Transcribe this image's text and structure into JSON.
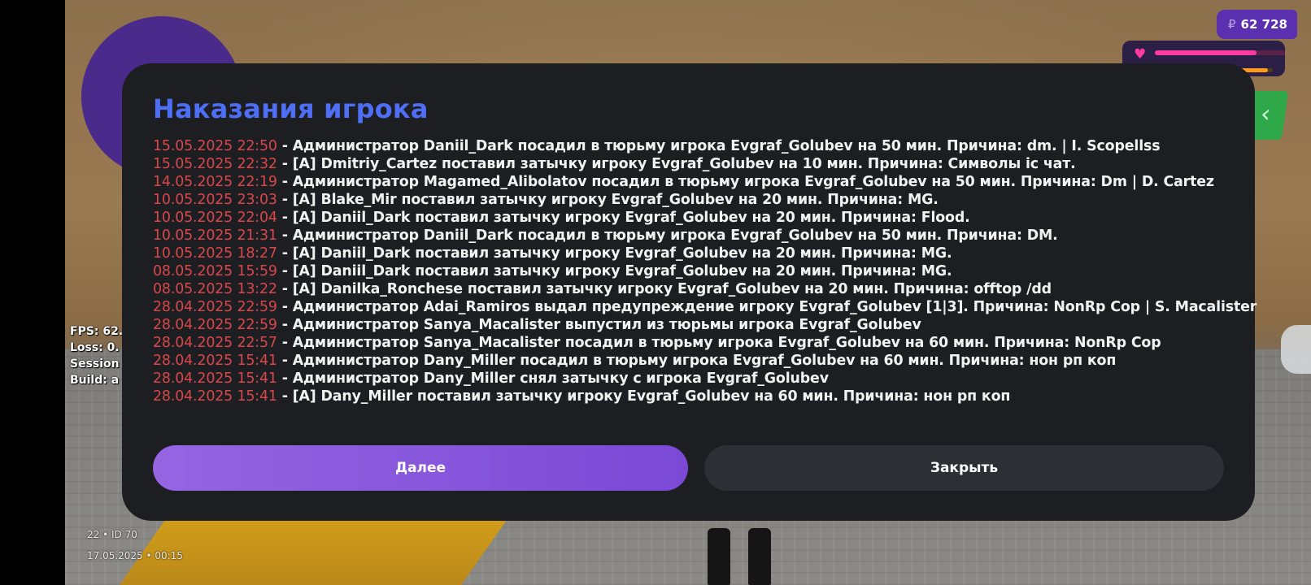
{
  "hud": {
    "money_currency": "₽",
    "money_amount": "62 728",
    "health_fraction": 0.78,
    "armor_fraction": 0.95,
    "fps_label": "FPS: 62.",
    "loss_label": "Loss: 0.",
    "session_label": "Session",
    "build_label": "Build: a",
    "player_id": "22 • ID 70",
    "datetime": "17.05.2025 • 00:15"
  },
  "modal": {
    "title": "Наказания игрока",
    "entries": [
      {
        "date": "15.05.2025 22:50",
        "text": " - Администратор Daniil_Dark посадил в тюрьму игрока Evgraf_Golubev на 50 мин. Причина: dm. | I. Scopellss"
      },
      {
        "date": "15.05.2025 22:32",
        "text": " - [A] Dmitriy_Cartez поставил затычку игроку Evgraf_Golubev на 10 мин. Причина: Символы ic чат."
      },
      {
        "date": "14.05.2025 22:19",
        "text": " - Администратор Magamed_Alibolatov посадил в тюрьму игрока Evgraf_Golubev на 50 мин. Причина: Dm | D. Cartez"
      },
      {
        "date": "10.05.2025 23:03",
        "text": " - [A] Blake_Mir поставил затычку игроку Evgraf_Golubev на 20 мин. Причина: MG."
      },
      {
        "date": "10.05.2025 22:04",
        "text": " - [A] Daniil_Dark поставил затычку игроку Evgraf_Golubev на 20 мин. Причина: Flood."
      },
      {
        "date": "10.05.2025 21:31",
        "text": " - Администратор Daniil_Dark посадил в тюрьму игрока Evgraf_Golubev на 50 мин. Причина: DM."
      },
      {
        "date": "10.05.2025 18:27",
        "text": " - [A] Daniil_Dark поставил затычку игроку Evgraf_Golubev на 20 мин. Причина: MG."
      },
      {
        "date": "08.05.2025 15:59",
        "text": " - [A] Daniil_Dark поставил затычку игроку Evgraf_Golubev на 20 мин. Причина: MG."
      },
      {
        "date": "08.05.2025 13:22",
        "text": " - [A] Danilka_Ronchese поставил затычку игроку Evgraf_Golubev на 20 мин. Причина: offtop /dd"
      },
      {
        "date": "28.04.2025 22:59",
        "text": " - Администратор Adai_Ramiros выдал предупреждение игроку Evgraf_Golubev [1|3]. Причина: NonRp Cop | S. Macalister"
      },
      {
        "date": "28.04.2025 22:59",
        "text": " - Администратор Sanya_Macalister выпустил из тюрьмы игрока Evgraf_Golubev"
      },
      {
        "date": "28.04.2025 22:57",
        "text": " - Администратор Sanya_Macalister посадил в тюрьму игрока Evgraf_Golubev на 60 мин. Причина: NonRp Cop"
      },
      {
        "date": "28.04.2025 15:41",
        "text": " - Администратор Dany_Miller посадил в тюрьму игрока Evgraf_Golubev на 60 мин. Причина: нон рп коп"
      },
      {
        "date": "28.04.2025 15:41",
        "text": " - Администратор Dany_Miller снял затычку с игрока Evgraf_Golubev"
      },
      {
        "date": "28.04.2025 15:41",
        "text": " - [A] Dany_Miller поставил затычку игроку Evgraf_Golubev на 60 мин. Причина: нон рп коп"
      }
    ],
    "next_label": "Далее",
    "close_label": "Закрыть"
  },
  "icons": {
    "heart": "heart-icon",
    "back": "chevron-left-icon"
  },
  "colors": {
    "title": "#4d6ef5",
    "date": "#d8474a",
    "modal_bg": "#1d1e22",
    "next_button": "#8a55dc",
    "close_button": "#2e2f34",
    "money_badge": "#5a2fb0",
    "health": "#ff3aa0",
    "armor": "#ff9a1a"
  }
}
